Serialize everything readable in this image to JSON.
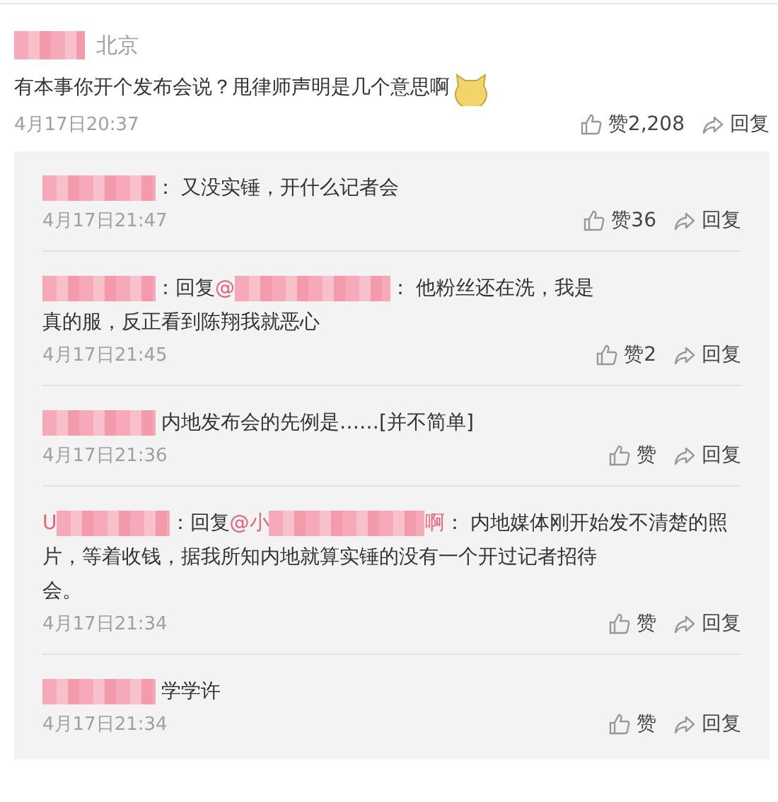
{
  "post": {
    "location": "北京",
    "text": "有本事你开个发布会说？甩律师声明是几个意思啊",
    "emoji": true,
    "time": "4月17日20:37",
    "like": "赞2,208",
    "reply": "回复"
  },
  "replies": [
    {
      "header": [
        {
          "kind": "blur"
        },
        {
          "kind": "text",
          "text": "："
        }
      ],
      "lines": [
        "又没实锤，开什么记者会"
      ],
      "time": "4月17日21:47",
      "like": "赞36",
      "reply": "回复"
    },
    {
      "header": [
        {
          "kind": "blur"
        },
        {
          "kind": "text",
          "text": "："
        },
        {
          "kind": "text",
          "text": "回复"
        },
        {
          "kind": "mention",
          "text": "@"
        },
        {
          "kind": "mention-blur"
        },
        {
          "kind": "text",
          "text": "："
        }
      ],
      "lines": [
        "他粉丝还在洗，我是",
        "真的服，反正看到陈翔我就恶心"
      ],
      "time": "4月17日21:45",
      "like": "赞2",
      "reply": "回复"
    },
    {
      "header": [
        {
          "kind": "blur"
        }
      ],
      "lines": [
        "内地发布会的先例是……[并不简单]"
      ],
      "time": "4月17日21:36",
      "like": "赞",
      "reply": "回复"
    },
    {
      "header": [
        {
          "kind": "mention",
          "text": "U"
        },
        {
          "kind": "blur"
        },
        {
          "kind": "text",
          "text": "："
        },
        {
          "kind": "text",
          "text": "回复"
        },
        {
          "kind": "mention",
          "text": "@小"
        },
        {
          "kind": "mention-blur"
        },
        {
          "kind": "mention",
          "text": "啊"
        },
        {
          "kind": "text",
          "text": "："
        }
      ],
      "lines": [
        "内地媒体刚开始发不清楚的照",
        "片，等着收钱，据我所知内地就算实锤的没有一个开过记者招待",
        "会。"
      ],
      "time": "4月17日21:34",
      "like": "赞",
      "reply": "回复"
    },
    {
      "header": [
        {
          "kind": "blur"
        }
      ],
      "lines": [
        "学学许"
      ],
      "time": "4月17日21:34",
      "like": "赞",
      "reply": "回复"
    }
  ]
}
